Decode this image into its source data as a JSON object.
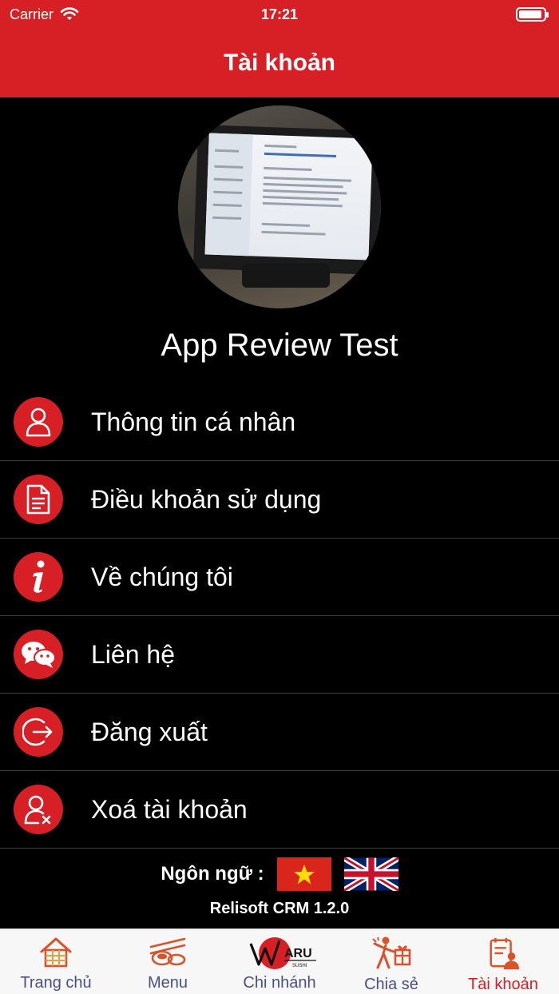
{
  "status_bar": {
    "carrier": "Carrier",
    "time": "17:21"
  },
  "nav": {
    "title": "Tài khoản"
  },
  "profile": {
    "name": "App Review Test"
  },
  "menu": [
    {
      "label": "Thông tin cá nhân",
      "icon": "user-icon"
    },
    {
      "label": "Điều khoản sử dụng",
      "icon": "document-icon"
    },
    {
      "label": "Về chúng tôi",
      "icon": "info-icon"
    },
    {
      "label": "Liên hệ",
      "icon": "chat-icon"
    },
    {
      "label": "Đăng xuất",
      "icon": "logout-icon"
    },
    {
      "label": "Xoá tài khoản",
      "icon": "user-remove-icon"
    }
  ],
  "language": {
    "label": "Ngôn ngữ :",
    "options": [
      "vietnam-flag",
      "uk-flag"
    ]
  },
  "version": "Relisoft CRM 1.2.0",
  "tabs": [
    {
      "label": "Trang chủ",
      "icon": "home-icon",
      "active": false
    },
    {
      "label": "Menu",
      "icon": "sushi-icon",
      "active": false
    },
    {
      "label": "Chi nhánh",
      "icon": "waru-logo",
      "logo_text": "ARU",
      "logo_sub": "SUSHI",
      "active": false
    },
    {
      "label": "Chia sẻ",
      "icon": "share-gift-icon",
      "active": false
    },
    {
      "label": "Tài khoản",
      "icon": "account-icon",
      "active": true
    }
  ],
  "colors": {
    "primary": "#d71f26",
    "tab_inactive": "#4a4f86",
    "background": "#000000"
  }
}
